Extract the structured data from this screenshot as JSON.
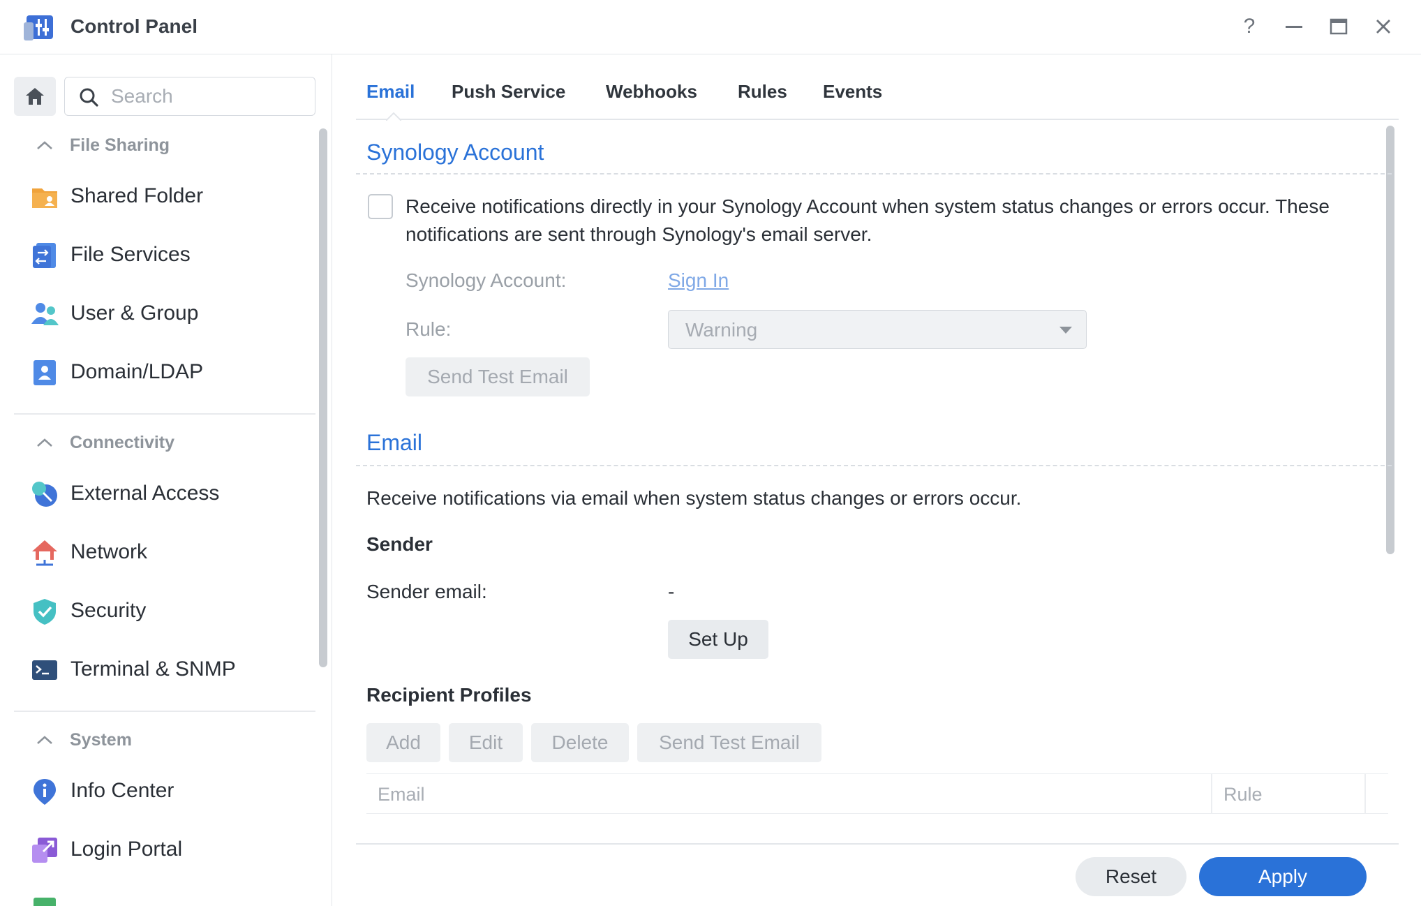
{
  "window": {
    "title": "Control Panel",
    "controls": {
      "help": "?",
      "minimize": "—",
      "maximize": "▭",
      "close": "✕"
    }
  },
  "sidebar": {
    "search_placeholder": "Search",
    "groups": [
      {
        "label": "File Sharing",
        "items": [
          {
            "label": "Shared Folder",
            "icon": "folder-share-icon"
          },
          {
            "label": "File Services",
            "icon": "file-services-icon"
          },
          {
            "label": "User & Group",
            "icon": "users-icon"
          },
          {
            "label": "Domain/LDAP",
            "icon": "domain-ldap-icon"
          }
        ]
      },
      {
        "label": "Connectivity",
        "items": [
          {
            "label": "External Access",
            "icon": "external-access-icon"
          },
          {
            "label": "Network",
            "icon": "network-icon"
          },
          {
            "label": "Security",
            "icon": "security-shield-icon"
          },
          {
            "label": "Terminal & SNMP",
            "icon": "terminal-icon"
          }
        ]
      },
      {
        "label": "System",
        "items": [
          {
            "label": "Info Center",
            "icon": "info-icon"
          },
          {
            "label": "Login Portal",
            "icon": "login-portal-icon"
          }
        ]
      }
    ]
  },
  "tabs": [
    {
      "label": "Email",
      "active": true
    },
    {
      "label": "Push Service",
      "active": false
    },
    {
      "label": "Webhooks",
      "active": false
    },
    {
      "label": "Rules",
      "active": false
    },
    {
      "label": "Events",
      "active": false
    }
  ],
  "synology_account": {
    "title": "Synology Account",
    "checkbox_checked": false,
    "description_line1": "Receive notifications directly in your Synology Account when system status changes or errors occur. These",
    "description_line2": "notifications are sent through Synology's email server.",
    "account_label": "Synology Account:",
    "sign_in_link": "Sign In",
    "rule_label": "Rule:",
    "rule_value": "Warning",
    "send_test_label": "Send Test Email"
  },
  "email": {
    "title": "Email",
    "description": "Receive notifications via email when system status changes or errors occur.",
    "sender_heading": "Sender",
    "sender_email_label": "Sender email:",
    "sender_email_value": "-",
    "setup_label": "Set Up",
    "recipients_heading": "Recipient Profiles",
    "buttons": {
      "add": "Add",
      "edit": "Edit",
      "delete": "Delete",
      "send_test": "Send Test Email"
    },
    "columns": {
      "email": "Email",
      "rule": "Rule"
    }
  },
  "footer": {
    "reset": "Reset",
    "apply": "Apply"
  },
  "colors": {
    "accent": "#2a72d8",
    "link_disabled": "#7fa8e6"
  }
}
